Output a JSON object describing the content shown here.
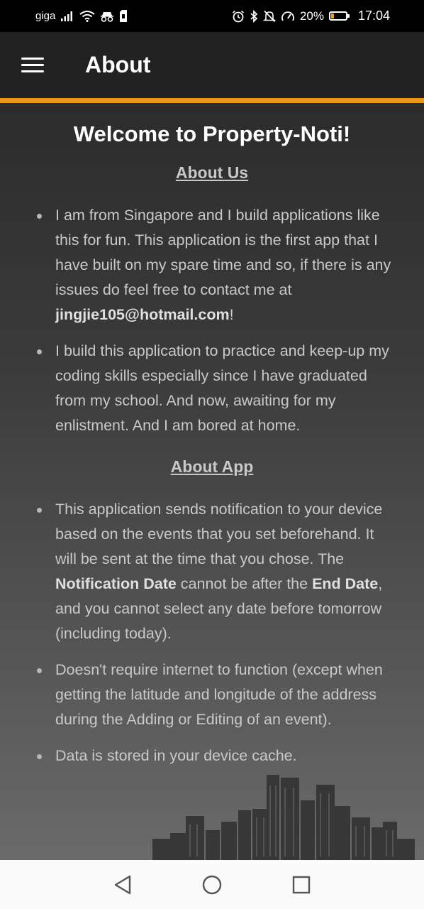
{
  "status_bar": {
    "carrier": "giga",
    "battery_percent": "20%",
    "battery_level": 0.2,
    "time": "17:04",
    "icons": [
      "signal-icon",
      "wifi-icon",
      "incognito-icon",
      "sim-icon",
      "alarm-icon",
      "bluetooth-icon",
      "mute-icon",
      "speed-icon",
      "battery-icon"
    ]
  },
  "app_bar": {
    "title": "About",
    "menu_icon": "hamburger-menu-icon"
  },
  "page": {
    "welcome": "Welcome to Property-Noti!",
    "about_us": {
      "title": "About Us",
      "items": [
        {
          "text_before": "I am from Singapore and I build applications like this for fun. This application is the first app that I have built on my spare time and so, if there is any issues do feel free to contact me at ",
          "email": "jingjie105@hotmail.com",
          "text_after": "!"
        },
        {
          "text": "I build this application to practice and keep-up my coding skills especially since I have graduated from my school. And now, awaiting for my enlistment. And I am bored at home."
        }
      ]
    },
    "about_app": {
      "title": "About App",
      "items": [
        {
          "part1": "This application sends notification to your device based on the events that you set beforehand. It will be sent at the time that you chose. The ",
          "bold1": "Notification Date",
          "part2": " cannot be after the ",
          "bold2": "End Date",
          "part3": ", and you cannot select any date before tomorrow (including today)."
        },
        {
          "text": "Doesn't require internet to function (except when getting the latitude and longitude of the address during the Adding or Editing of an event)."
        },
        {
          "text": "Data is stored in your device cache."
        }
      ]
    }
  },
  "nav_bar": {
    "buttons": [
      "back-icon",
      "home-icon",
      "recents-icon"
    ]
  },
  "colors": {
    "accent": "#e89a16",
    "app_bar": "#222222",
    "battery_fill": "#f29b18"
  }
}
